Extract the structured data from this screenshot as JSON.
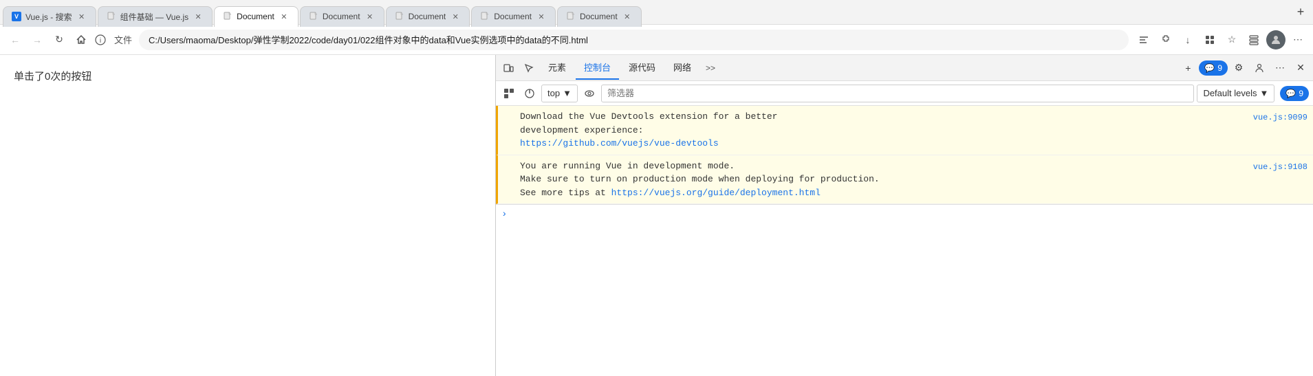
{
  "browser": {
    "tabs": [
      {
        "id": "tab1",
        "favicon_type": "vuejs",
        "title": "Vue.js - 搜索",
        "active": false
      },
      {
        "id": "tab2",
        "favicon_type": "doc",
        "title": "组件基础 — Vue.js",
        "active": false
      },
      {
        "id": "tab3",
        "favicon_type": "doc",
        "title": "Document",
        "active": true
      },
      {
        "id": "tab4",
        "favicon_type": "doc",
        "title": "Document",
        "active": false
      },
      {
        "id": "tab5",
        "favicon_type": "doc",
        "title": "Document",
        "active": false
      },
      {
        "id": "tab6",
        "favicon_type": "doc",
        "title": "Document",
        "active": false
      },
      {
        "id": "tab7",
        "favicon_type": "doc",
        "title": "Document",
        "active": false
      }
    ],
    "address": "C:/Users/maoma/Desktop/弹性学制2022/code/day01/022组件对象中的data和Vue实例选项中的data的不同.html",
    "file_label": "文件",
    "nav": {
      "back_disabled": true,
      "forward_disabled": true
    }
  },
  "page": {
    "button_text": "单击了0次的按钮"
  },
  "devtools": {
    "tabs": [
      {
        "id": "elements",
        "label": "元素",
        "active": false
      },
      {
        "id": "console",
        "label": "控制台",
        "active": true
      },
      {
        "id": "sources",
        "label": "源代码",
        "active": false
      },
      {
        "id": "network",
        "label": "网络",
        "active": false
      }
    ],
    "more_tabs_label": ">>",
    "toolbar_buttons": [
      {
        "id": "add",
        "symbol": "+",
        "label": "新建"
      },
      {
        "id": "messages",
        "count": "9"
      },
      {
        "id": "settings",
        "symbol": "⚙",
        "label": "设置"
      },
      {
        "id": "connect",
        "symbol": "👤",
        "label": "连接"
      },
      {
        "id": "more",
        "symbol": "⋯",
        "label": "更多"
      },
      {
        "id": "close",
        "symbol": "✕",
        "label": "关闭"
      }
    ],
    "console": {
      "context": "top",
      "filter_placeholder": "筛选器",
      "levels": "Default levels",
      "message_count": "9",
      "messages": [
        {
          "id": "msg1",
          "type": "warning",
          "text_line1": "Download the Vue Devtools extension for a better",
          "text_line2": "development experience:",
          "link": "https://github.com/vuejs/vue-devtools",
          "source": "vue.js:9099"
        },
        {
          "id": "msg2",
          "type": "warning",
          "text_line1": "You are running Vue in development mode.",
          "text_line2": "Make sure to turn on production mode when deploying for production.",
          "text_line3": "See more tips at ",
          "link2": "https://vuejs.org/guide/deployment.html",
          "source": "vue.js:9108"
        }
      ],
      "chevron_symbol": "›"
    }
  }
}
